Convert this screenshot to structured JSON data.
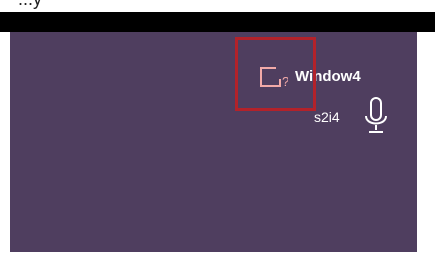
{
  "header": {
    "partial_text": "...y"
  },
  "window": {
    "title": "Window4",
    "subtitle": "s2i4",
    "icon": "unknown-window-icon",
    "mic_icon": "microphone-icon"
  },
  "colors": {
    "panel": "#4f3e5f",
    "highlight": "#b3222a",
    "text": "#ffffff"
  }
}
